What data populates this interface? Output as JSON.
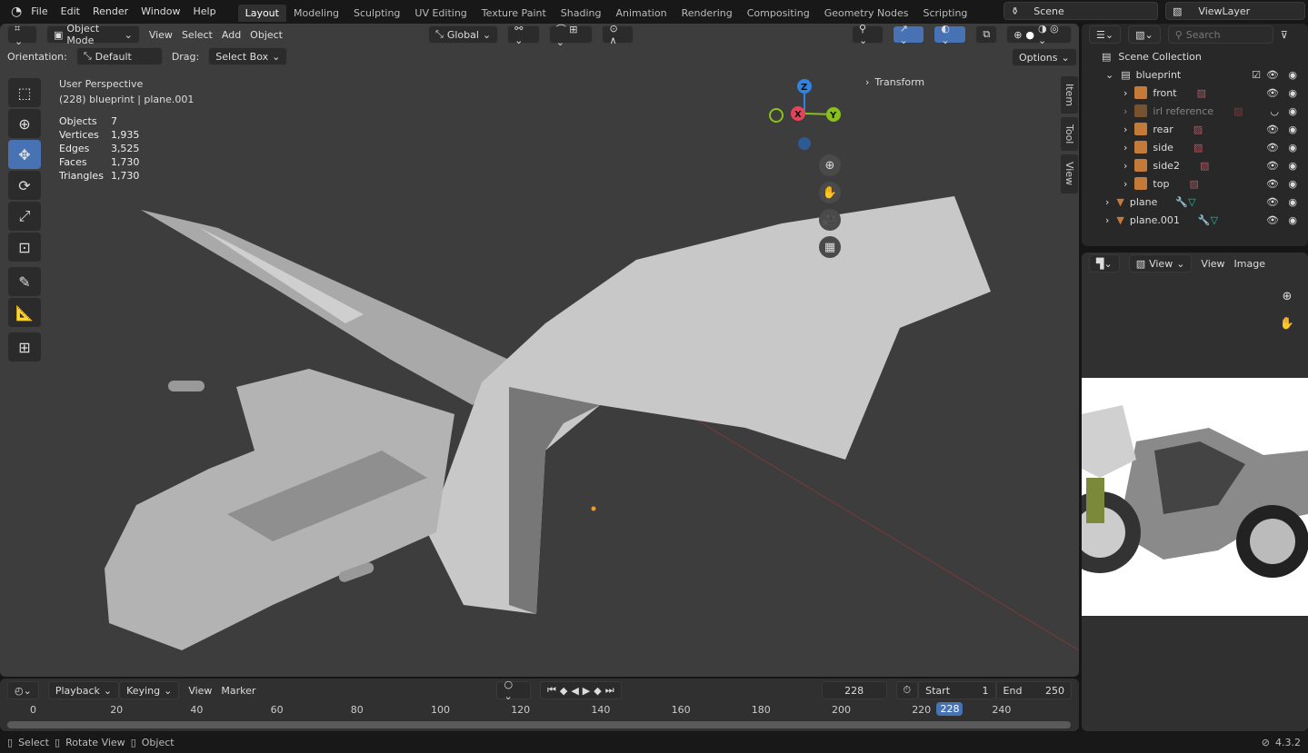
{
  "topbar": {
    "menus": [
      "File",
      "Edit",
      "Render",
      "Window",
      "Help"
    ],
    "workspaces": [
      "Layout",
      "Modeling",
      "Sculpting",
      "UV Editing",
      "Texture Paint",
      "Shading",
      "Animation",
      "Rendering",
      "Compositing",
      "Geometry Nodes",
      "Scripting"
    ],
    "scene": "Scene",
    "view_layer": "ViewLayer"
  },
  "viewport": {
    "mode": "Object Mode",
    "menus": [
      "View",
      "Select",
      "Add",
      "Object"
    ],
    "transform_orientation": "Global",
    "orientation_label": "Orientation:",
    "orientation": "Default",
    "drag_label": "Drag:",
    "drag": "Select Box",
    "options": "Options",
    "overlay_title": "User Perspective",
    "overlay_sub": "(228) blueprint | plane.001",
    "stats": [
      [
        "Objects",
        "7"
      ],
      [
        "Vertices",
        "1,935"
      ],
      [
        "Edges",
        "3,525"
      ],
      [
        "Faces",
        "1,730"
      ],
      [
        "Triangles",
        "1,730"
      ]
    ],
    "transform_panel": "Transform",
    "side_tabs": [
      "Item",
      "Tool",
      "View"
    ],
    "gizmo": {
      "x": "X",
      "y": "Y",
      "z": "Z"
    },
    "colors": {
      "accent": "#4772b3",
      "x": "#e8425a",
      "y": "#8ac01d",
      "z": "#2f83e3"
    }
  },
  "outliner": {
    "search_placeholder": "Search",
    "root": "Scene Collection",
    "collection": "blueprint",
    "children": [
      "front",
      "irl reference",
      "rear",
      "side",
      "side2",
      "top"
    ],
    "objects": [
      "plane",
      "plane.001"
    ]
  },
  "image_editor": {
    "view_dropdown": "View",
    "menus": [
      "View",
      "Image"
    ]
  },
  "timeline": {
    "menus": [
      "Playback",
      "Keying",
      "View",
      "Marker"
    ],
    "current_frame": "228",
    "start_label": "Start",
    "start": "1",
    "end_label": "End",
    "end": "250",
    "ticks": [
      "0",
      "20",
      "40",
      "60",
      "80",
      "100",
      "120",
      "140",
      "160",
      "180",
      "200",
      "220",
      "240"
    ]
  },
  "status": {
    "hints": [
      "Select",
      "Rotate View",
      "Object"
    ],
    "version": "4.3.2"
  }
}
